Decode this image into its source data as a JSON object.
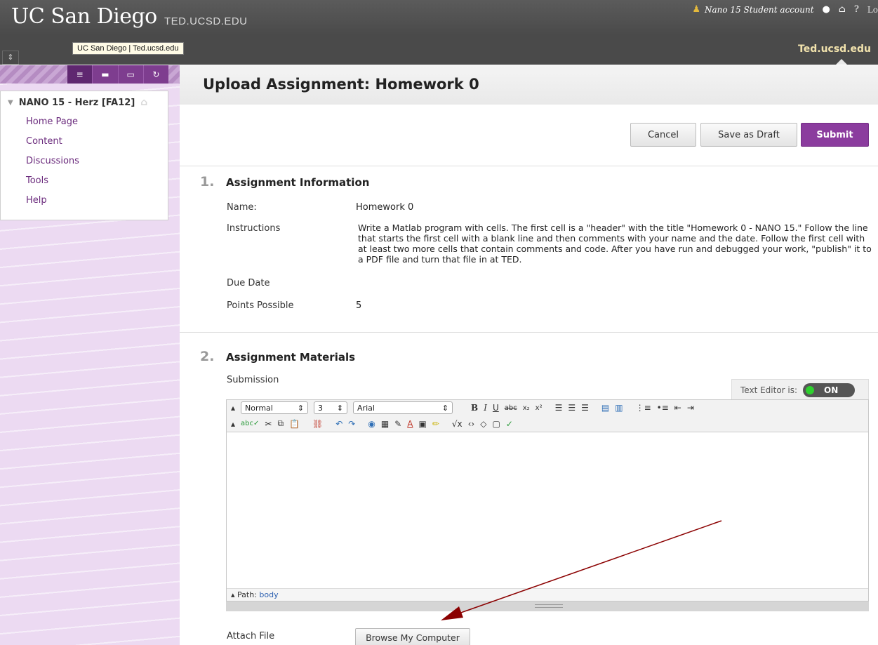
{
  "header": {
    "brand": "UC San Diego",
    "subbrand": "TED.UCSD.EDU",
    "account_name": "Nano 15 Student account",
    "account_icon": "person-icon",
    "icons": [
      "user-icon",
      "home-icon",
      "help-icon"
    ],
    "logout_partial": "Lo",
    "tooltip": "UC San Diego | Ted.ucsd.edu",
    "site_link": "Ted.ucsd.edu"
  },
  "sidebar": {
    "tools": [
      {
        "name": "menu-list-icon",
        "glyph": "≡"
      },
      {
        "name": "folder-icon",
        "glyph": "▬"
      },
      {
        "name": "window-icon",
        "glyph": "▭"
      },
      {
        "name": "refresh-icon",
        "glyph": "↻"
      }
    ],
    "course_title": "NANO 15 - Herz [FA12]",
    "items": [
      {
        "label": "Home Page"
      },
      {
        "label": "Content"
      },
      {
        "label": "Discussions"
      },
      {
        "label": "Tools"
      },
      {
        "label": "Help"
      }
    ]
  },
  "page": {
    "title": "Upload Assignment: Homework 0",
    "buttons": {
      "cancel": "Cancel",
      "save_draft": "Save as Draft",
      "submit": "Submit"
    }
  },
  "section1": {
    "num": "1.",
    "title": "Assignment Information",
    "name_label": "Name:",
    "name_value": "Homework 0",
    "instructions_label": "Instructions",
    "instructions_value": "Write a Matlab program with cells. The first cell is a \"header\" with the title \"Homework 0 - NANO 15.\" Follow the line that starts the first cell with a blank line and then comments with your name and the date. Follow the first cell with at least two more cells that contain comments and code. After you have run and debugged your work, \"publish\" it to a PDF file and turn that file in at TED.",
    "due_label": "Due Date",
    "points_label": "Points Possible",
    "points_value": "5"
  },
  "section2": {
    "num": "2.",
    "title": "Assignment Materials",
    "submission_label": "Submission",
    "text_editor_label": "Text Editor is:",
    "text_editor_state": "ON",
    "editor": {
      "format": "Normal",
      "size": "3",
      "font": "Arial",
      "path_label": "Path:",
      "path_value": "body"
    },
    "attach_label": "Attach File",
    "browse_button": "Browse My Computer"
  },
  "colors": {
    "accent": "#8b3c9e",
    "header_bg": "#4a4a4a",
    "sidebar_bg": "#ecdaf2",
    "arrow": "#8b0000"
  }
}
